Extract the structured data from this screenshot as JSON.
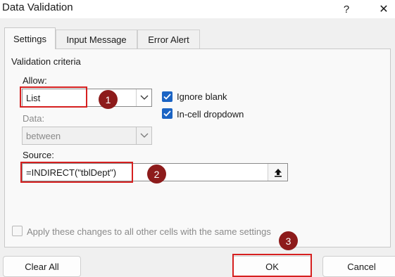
{
  "window": {
    "title": "Data Validation",
    "help": "?",
    "close": "✕"
  },
  "tabs": [
    {
      "label": "Settings",
      "active": true
    },
    {
      "label": "Input Message",
      "active": false
    },
    {
      "label": "Error Alert",
      "active": false
    }
  ],
  "settings": {
    "group_label": "Validation criteria",
    "allow_label": "Allow:",
    "allow_value": "List",
    "data_label": "Data:",
    "data_value": "between",
    "ignore_blank_label": "Ignore blank",
    "ignore_blank_checked": true,
    "incell_dropdown_label": "In-cell dropdown",
    "incell_dropdown_checked": true,
    "source_label": "Source:",
    "source_value": "=INDIRECT(\"tblDept\")",
    "apply_label": "Apply these changes to all other cells with the same settings",
    "apply_checked": false
  },
  "buttons": {
    "clear_all": "Clear All",
    "ok": "OK",
    "cancel": "Cancel"
  },
  "annotations": {
    "badge_1": "1",
    "badge_2": "2",
    "badge_3": "3",
    "highlight_color": "#d62020",
    "badge_color": "#8d1b1b"
  },
  "colors": {
    "checkbox_accent": "#1b64c4"
  },
  "icons": {
    "allow_dropdown": "chevron-down-icon",
    "data_dropdown": "chevron-down-icon",
    "range_selector": "collapse-dialog-arrow-icon",
    "checkmark": "checkmark-icon"
  }
}
